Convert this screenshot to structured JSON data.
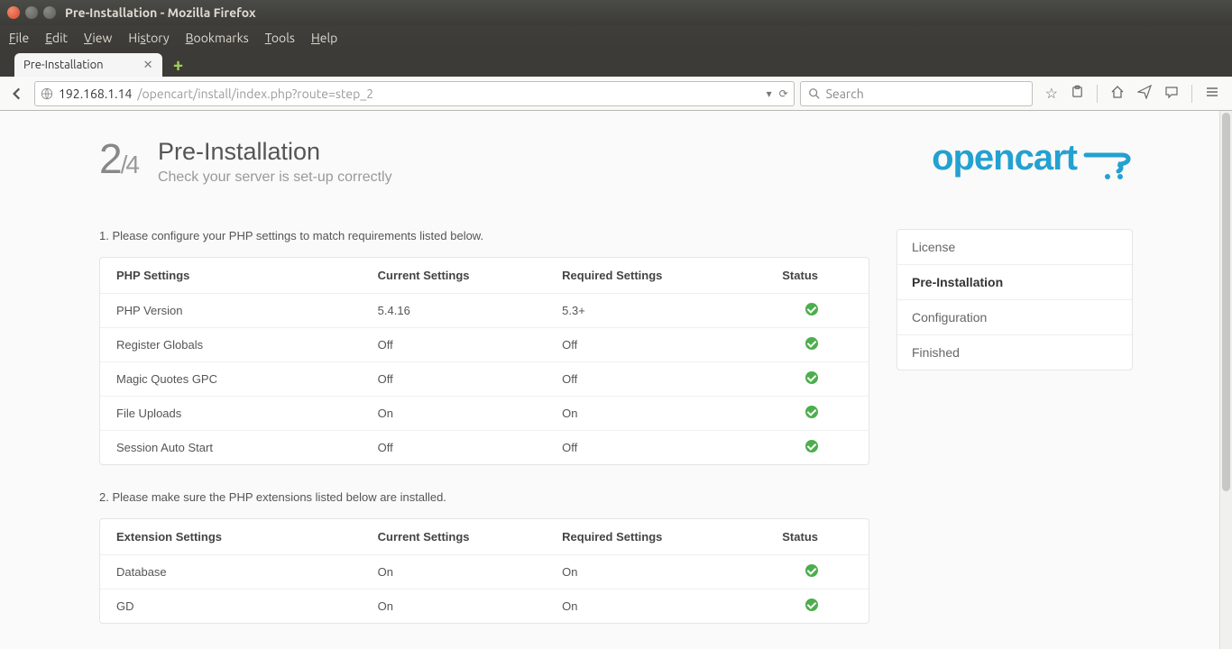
{
  "window": {
    "title": "Pre-Installation - Mozilla Firefox"
  },
  "menubar": [
    "File",
    "Edit",
    "View",
    "History",
    "Bookmarks",
    "Tools",
    "Help"
  ],
  "tab": {
    "title": "Pre-Installation"
  },
  "url": {
    "host": "192.168.1.14",
    "path": "/opencart/install/index.php?route=step_2"
  },
  "search": {
    "placeholder": "Search"
  },
  "page": {
    "step_current": "2",
    "step_total": "/4",
    "title": "Pre-Installation",
    "subtitle": "Check your server is set-up correctly",
    "logo_text": "opencart"
  },
  "section1_label": "1. Please configure your PHP settings to match requirements listed below.",
  "table1": {
    "headers": [
      "PHP Settings",
      "Current Settings",
      "Required Settings",
      "Status"
    ],
    "rows": [
      {
        "name": "PHP Version",
        "current": "5.4.16",
        "required": "5.3+",
        "ok": true
      },
      {
        "name": "Register Globals",
        "current": "Off",
        "required": "Off",
        "ok": true
      },
      {
        "name": "Magic Quotes GPC",
        "current": "Off",
        "required": "Off",
        "ok": true
      },
      {
        "name": "File Uploads",
        "current": "On",
        "required": "On",
        "ok": true
      },
      {
        "name": "Session Auto Start",
        "current": "Off",
        "required": "Off",
        "ok": true
      }
    ]
  },
  "section2_label": "2. Please make sure the PHP extensions listed below are installed.",
  "table2": {
    "headers": [
      "Extension Settings",
      "Current Settings",
      "Required Settings",
      "Status"
    ],
    "rows": [
      {
        "name": "Database",
        "current": "On",
        "required": "On",
        "ok": true
      },
      {
        "name": "GD",
        "current": "On",
        "required": "On",
        "ok": true
      }
    ]
  },
  "steps": [
    {
      "label": "License",
      "active": false
    },
    {
      "label": "Pre-Installation",
      "active": true
    },
    {
      "label": "Configuration",
      "active": false
    },
    {
      "label": "Finished",
      "active": false
    }
  ]
}
